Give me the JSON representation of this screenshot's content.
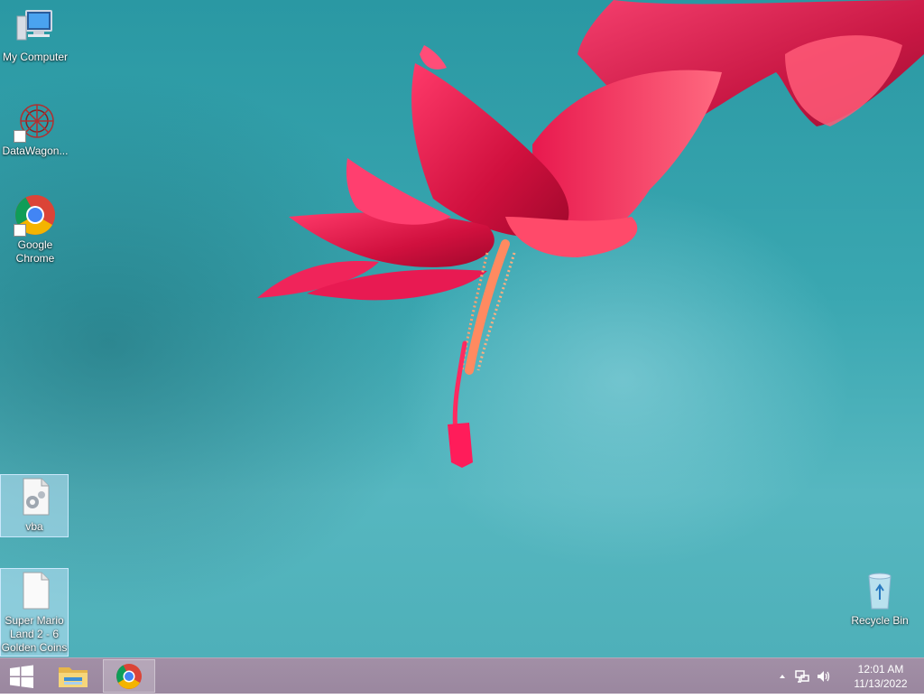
{
  "desktop": {
    "icons": [
      {
        "label": "My Computer",
        "icon": "my-computer-icon"
      },
      {
        "label": "DataWagon...",
        "icon": "datawagon-icon"
      },
      {
        "label": "Google Chrome",
        "icon": "chrome-icon"
      },
      {
        "label": "vba",
        "icon": "settings-file-icon"
      },
      {
        "label": "Super Mario Land 2 - 6 Golden Coins",
        "icon": "blank-file-icon"
      },
      {
        "label": "Recycle Bin",
        "icon": "recycle-bin-icon"
      }
    ]
  },
  "taskbar": {
    "start": {
      "icon": "windows-logo-icon"
    },
    "apps": [
      {
        "name": "File Explorer",
        "icon": "file-explorer-icon",
        "active": false
      },
      {
        "name": "Google Chrome",
        "icon": "chrome-icon",
        "active": true
      }
    ],
    "tray": {
      "icons": [
        "show-hidden-icons-chevron",
        "network-icon",
        "volume-icon"
      ]
    },
    "clock": {
      "time": "12:01 AM",
      "date": "11/13/2022"
    }
  },
  "colors": {
    "desktop_background": "#3aa7b1",
    "taskbar": "#9f8ca3",
    "flower": "#e8194e"
  }
}
